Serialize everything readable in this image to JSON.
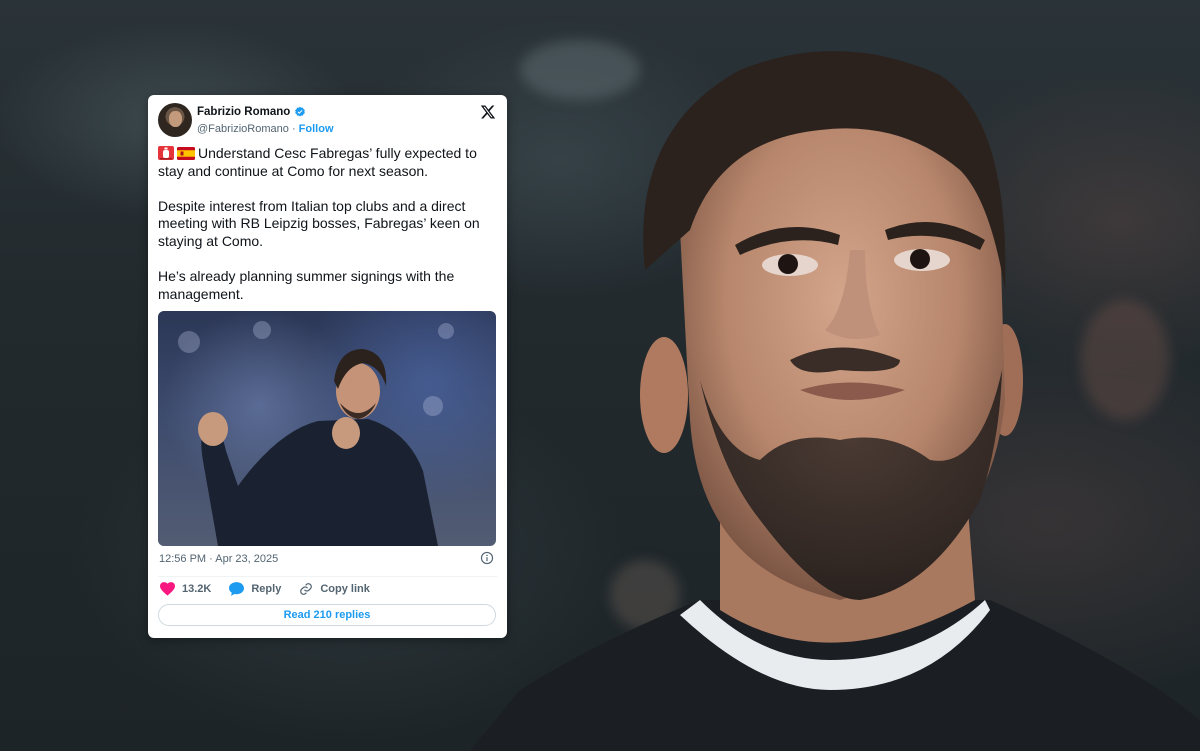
{
  "tweet": {
    "author_name": "Fabrizio Romano",
    "handle": "@FabrizioRomano",
    "separator": "·",
    "follow_label": "Follow",
    "paragraphs": [
      "Understand Cesc Fabregas’ fully expected to stay and continue at Como for next season.",
      "Despite interest from Italian top clubs and a direct meeting with RB Leipzig bosses, Fabregas’ keen on staying at Como.",
      "He’s already planning summer signings with the management."
    ],
    "timestamp": "12:56 PM · Apr 23, 2025",
    "like_count": "13.2K",
    "reply_label": "Reply",
    "copy_link_label": "Copy link",
    "read_replies_label": "Read 210 replies"
  },
  "colors": {
    "accent_blue": "#1d9bf0",
    "like_pink": "#f91880",
    "text_primary": "#0f1419",
    "text_secondary": "#536471"
  },
  "icons": {
    "verified": "verified-badge-icon",
    "x_logo": "x-logo-icon",
    "siren": "siren-emoji-icon",
    "flag": "spain-flag-icon",
    "info": "info-icon",
    "heart": "heart-icon",
    "reply": "speech-bubble-icon",
    "link": "link-icon"
  }
}
